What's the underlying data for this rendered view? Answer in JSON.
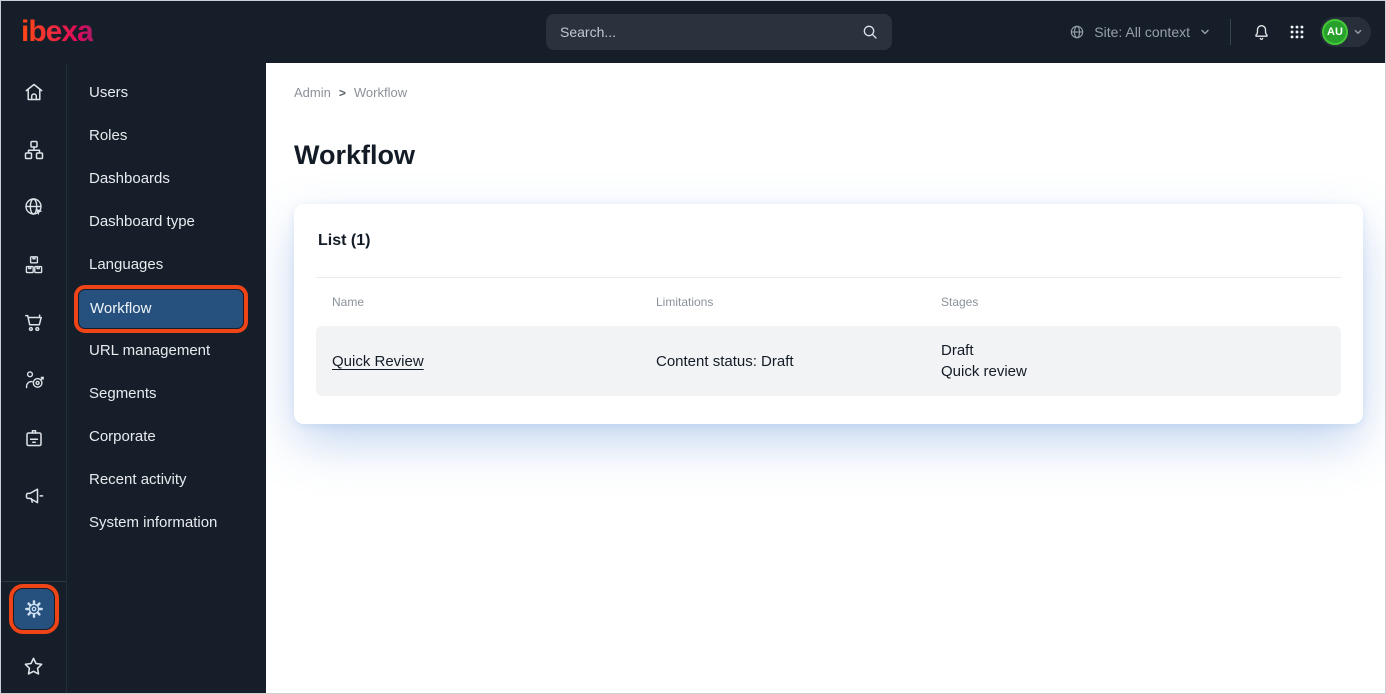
{
  "topbar": {
    "logo_text": "ibexa",
    "search_placeholder": "Search...",
    "site_context_label": "Site: All context",
    "avatar_initials": "AU"
  },
  "icon_rail": {
    "items": [
      {
        "icon": "home-icon"
      },
      {
        "icon": "content-tree-icon"
      },
      {
        "icon": "site-globe-icon"
      },
      {
        "icon": "products-boxes-icon"
      },
      {
        "icon": "commerce-cart-icon"
      },
      {
        "icon": "personalization-target-icon"
      },
      {
        "icon": "corporate-badge-icon"
      },
      {
        "icon": "marketing-megaphone-icon"
      },
      {
        "icon": "settings-gear-icon",
        "active": true,
        "annotated": true
      },
      {
        "icon": "favorites-star-icon"
      }
    ]
  },
  "sidebar": {
    "items": [
      {
        "label": "Users"
      },
      {
        "label": "Roles"
      },
      {
        "label": "Dashboards"
      },
      {
        "label": "Dashboard type"
      },
      {
        "label": "Languages"
      },
      {
        "label": "Workflow",
        "active": true,
        "annotated": true
      },
      {
        "label": "URL management"
      },
      {
        "label": "Segments"
      },
      {
        "label": "Corporate"
      },
      {
        "label": "Recent activity"
      },
      {
        "label": "System information"
      }
    ]
  },
  "breadcrumb": {
    "items": [
      "Admin",
      "Workflow"
    ],
    "separator": ">"
  },
  "page": {
    "title": "Workflow"
  },
  "card": {
    "heading": "List (1)",
    "table": {
      "columns": [
        "Name",
        "Limitations",
        "Stages"
      ],
      "rows": [
        {
          "name": "Quick Review",
          "limitations": "Content status: Draft",
          "stages": [
            "Draft",
            "Quick review"
          ]
        }
      ]
    }
  },
  "colors": {
    "topbar_bg": "#151e29",
    "active_blue": "#26517e",
    "annotation_red": "#ee4418",
    "avatar_green_fill": "#27a02c",
    "avatar_green_ring": "#44c936",
    "row_bg": "#f2f3f5",
    "muted_text": "#8b929a",
    "dark_text": "#131c26"
  }
}
